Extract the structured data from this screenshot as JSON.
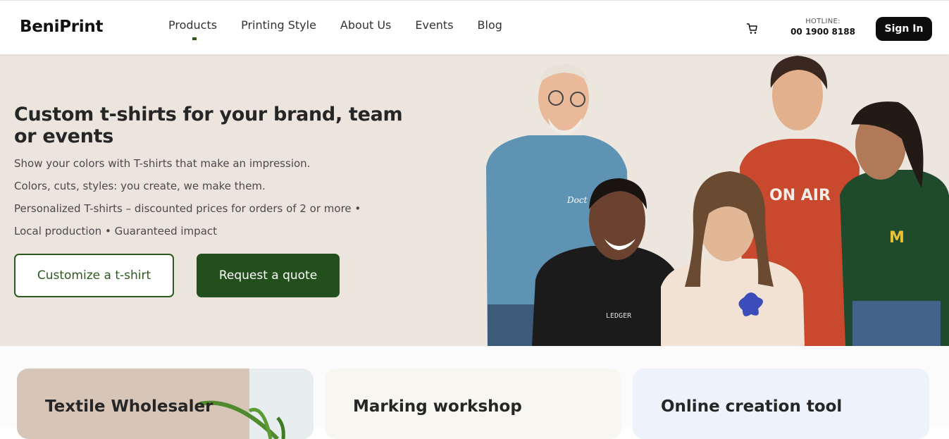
{
  "header": {
    "logo": "BeniPrint",
    "nav": [
      "Products",
      "Printing Style",
      "About Us",
      "Events",
      "Blog"
    ],
    "hotline_label": "HOTLINE:",
    "hotline_number": "00 1900 8188",
    "signin_label": "Sign In",
    "cart_icon": "cart-icon"
  },
  "hero": {
    "title": "Custom t-shirts for your brand, team or events",
    "lines": [
      "Show your colors with T-shirts that make an impression.",
      "Colors, cuts, styles: you create, we make them.",
      "Personalized T-shirts – discounted prices for orders of 2 or more •",
      "Local production • Guaranteed impact"
    ],
    "btn_customize": "Customize a t-shirt",
    "btn_quote": "Request a quote",
    "shirt_texts": [
      "Doct",
      "LEDGER",
      "ON AIR",
      "M"
    ]
  },
  "cards": [
    {
      "title": "Textile Wholesaler"
    },
    {
      "title": "Marking workshop"
    },
    {
      "title": "Online creation tool"
    }
  ],
  "colors": {
    "brand_green": "#234f1d",
    "hero_bg": "#ebe5dd",
    "signin_bg": "#0d0d0d"
  }
}
